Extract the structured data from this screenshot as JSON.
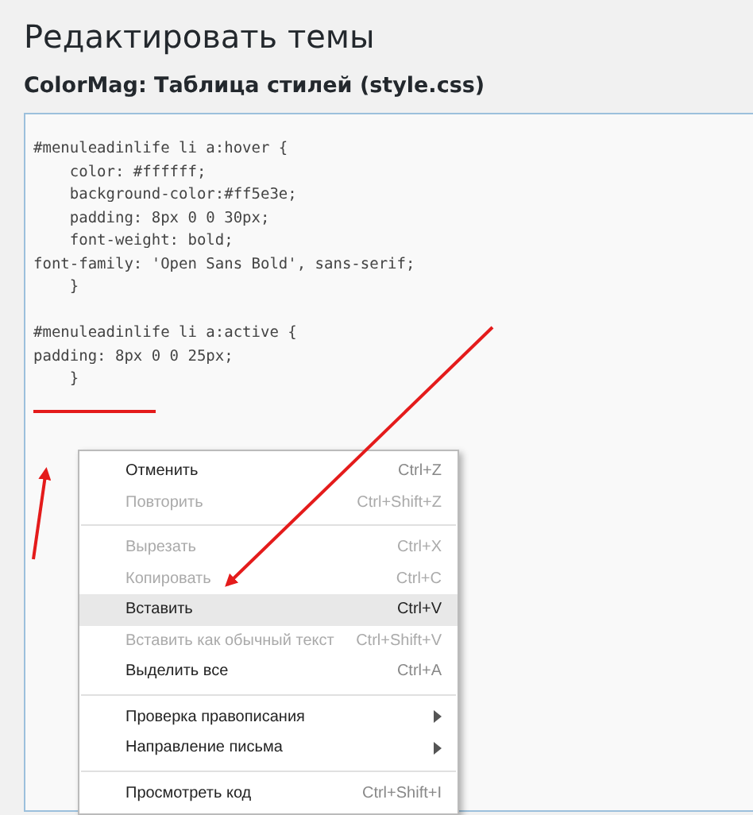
{
  "page_title": "Редактировать темы",
  "file_title": "ColorMag: Таблица стилей (style.css)",
  "code_blocks": [
    [
      "#menuleadinlife li a:hover {",
      "    color: #ffffff;",
      "    background-color:#ff5e3e;",
      "    padding: 8px 0 0 30px;",
      "    font-weight: bold;",
      "font-family: 'Open Sans Bold', sans-serif;",
      "    }"
    ],
    [
      "#menuleadinlife li a:active {",
      "padding: 8px 0 0 25px;",
      "    }"
    ]
  ],
  "context_menu": {
    "groups": [
      [
        {
          "label": "Отменить",
          "shortcut": "Ctrl+Z",
          "disabled": false,
          "selected": false,
          "submenu": false
        },
        {
          "label": "Повторить",
          "shortcut": "Ctrl+Shift+Z",
          "disabled": true,
          "selected": false,
          "submenu": false
        }
      ],
      [
        {
          "label": "Вырезать",
          "shortcut": "Ctrl+X",
          "disabled": true,
          "selected": false,
          "submenu": false
        },
        {
          "label": "Копировать",
          "shortcut": "Ctrl+C",
          "disabled": true,
          "selected": false,
          "submenu": false
        },
        {
          "label": "Вставить",
          "shortcut": "Ctrl+V",
          "disabled": false,
          "selected": true,
          "submenu": false
        },
        {
          "label": "Вставить как обычный текст",
          "shortcut": "Ctrl+Shift+V",
          "disabled": true,
          "selected": false,
          "submenu": false
        },
        {
          "label": "Выделить все",
          "shortcut": "Ctrl+A",
          "disabled": false,
          "selected": false,
          "submenu": false
        }
      ],
      [
        {
          "label": "Проверка правописания",
          "disabled": false,
          "selected": false,
          "submenu": true
        },
        {
          "label": "Направление письма",
          "disabled": false,
          "selected": false,
          "submenu": true
        }
      ],
      [
        {
          "label": "Просмотреть код",
          "shortcut": "Ctrl+Shift+I",
          "disabled": false,
          "selected": false,
          "submenu": false
        }
      ]
    ]
  }
}
